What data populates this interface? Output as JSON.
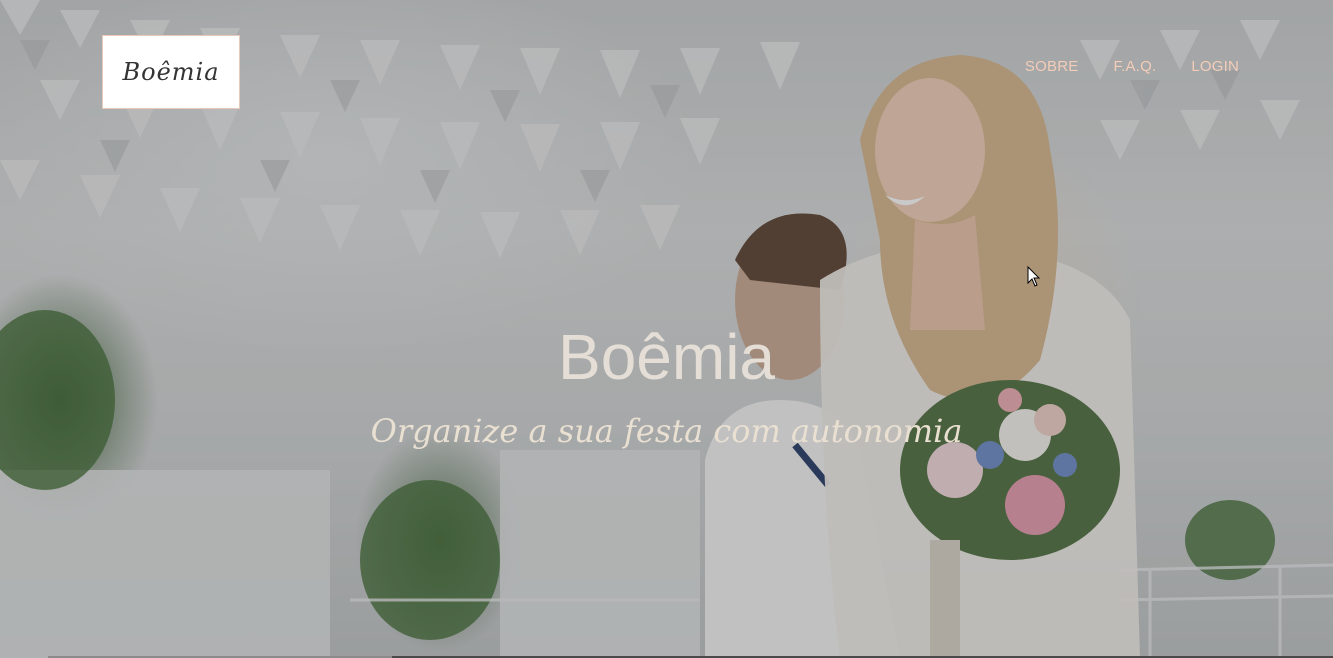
{
  "logo": {
    "text": "Boêmia"
  },
  "nav": {
    "items": [
      {
        "label": "SOBRE"
      },
      {
        "label": "F.A.Q."
      },
      {
        "label": "LOGIN"
      }
    ]
  },
  "hero": {
    "title": "Boêmia",
    "subtitle": "Organize a sua festa com autonomia"
  },
  "colors": {
    "nav_text": "#f3cdb8",
    "title_text": "#e4ded6",
    "subtitle_text": "#e9e0d2"
  }
}
